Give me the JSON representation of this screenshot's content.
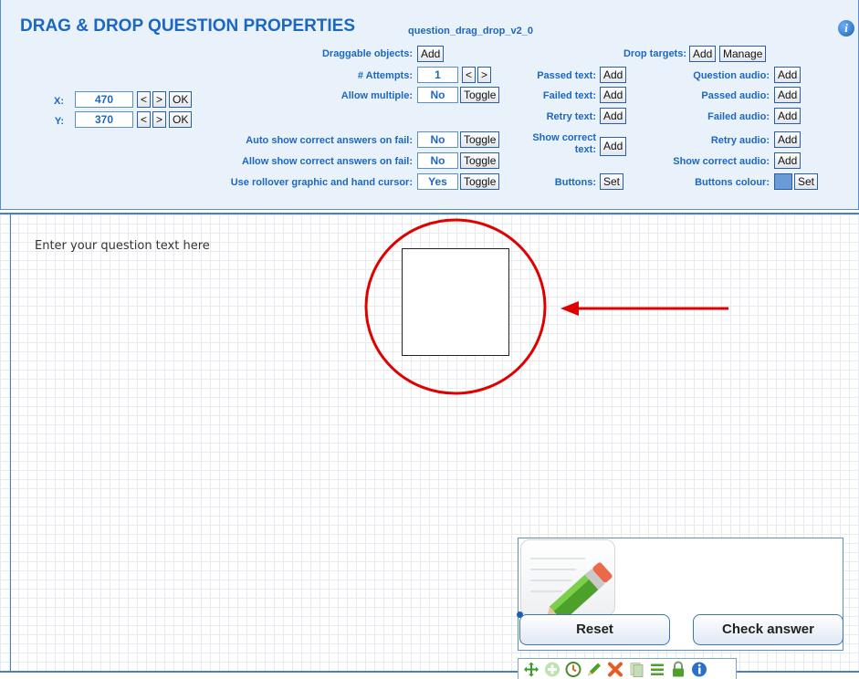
{
  "panel": {
    "title": "DRAG & DROP QUESTION PROPERTIES",
    "subtitle": "question_drag_drop_v2_0",
    "info_glyph": "i",
    "draggable_objects_label": "Draggable objects:",
    "drop_targets_label": "Drop targets:",
    "attempts_label": "# Attempts:",
    "attempts_value": "1",
    "allow_multiple_label": "Allow multiple:",
    "allow_multiple_value": "No",
    "x_label": "X:",
    "x_value": "470",
    "y_label": "Y:",
    "y_value": "370",
    "passed_text_label": "Passed text:",
    "failed_text_label": "Failed text:",
    "retry_text_label": "Retry text:",
    "show_correct_text_label_1": "Show correct",
    "show_correct_text_label_2": "text:",
    "buttons_label": "Buttons:",
    "question_audio_label": "Question audio:",
    "passed_audio_label": "Passed audio:",
    "failed_audio_label": "Failed audio:",
    "retry_audio_label": "Retry audio:",
    "show_correct_audio_label": "Show correct audio:",
    "buttons_colour_label": "Buttons colour:",
    "auto_show_label": "Auto show correct answers on fail:",
    "auto_show_value": "No",
    "allow_show_label": "Allow show correct answers on fail:",
    "allow_show_value": "No",
    "rollover_label": "Use rollover graphic and hand cursor:",
    "rollover_value": "Yes",
    "buttons_colour_hex": "#6a9bd6"
  },
  "controls": {
    "add": "Add",
    "manage": "Manage",
    "toggle": "Toggle",
    "ok": "OK",
    "set": "Set",
    "prev": "<",
    "next": ">"
  },
  "stage": {
    "question_text": "Enter your question text here"
  },
  "widget": {
    "reset_label": "Reset",
    "check_label": "Check answer"
  },
  "toolbar": {
    "icons": [
      "move-icon",
      "add-icon",
      "clock-icon",
      "edit-icon",
      "delete-icon",
      "copy-icon",
      "list-icon",
      "lock-icon",
      "info-icon"
    ]
  },
  "colors": {
    "accent": "#1c67c2",
    "panel_bg": "#e9f2fb",
    "annotation_red": "#e00000"
  }
}
